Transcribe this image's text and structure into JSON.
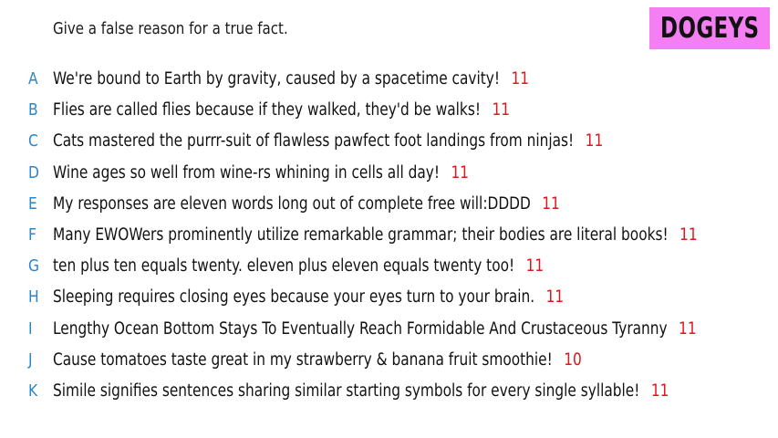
{
  "prompt": "Give a false reason for a true fact.",
  "logo": "DOGEYS",
  "entries": [
    {
      "letter": "A",
      "text": "We're bound to Earth by gravity, caused by a spacetime cavity!",
      "count": "11"
    },
    {
      "letter": "B",
      "text": "Flies are called flies because if they walked, they'd be walks!",
      "count": "11"
    },
    {
      "letter": "C",
      "text": "Cats mastered the purrr-suit of flawless pawfect foot landings from ninjas!",
      "count": "11"
    },
    {
      "letter": "D",
      "text": "Wine ages so well from wine-rs whining in cells all day!",
      "count": "11"
    },
    {
      "letter": "E",
      "text": "My responses are eleven words long out of complete free will:DDDD",
      "count": "11"
    },
    {
      "letter": "F",
      "text": "Many EWOWers prominently utilize remarkable grammar; their bodies are literal books!",
      "count": "11"
    },
    {
      "letter": "G",
      "text": "ten plus ten equals twenty. eleven plus eleven equals twenty too!",
      "count": "11"
    },
    {
      "letter": "H",
      "text": "Sleeping requires closing eyes because your eyes turn to your brain.",
      "count": "11"
    },
    {
      "letter": "I",
      "text": "Lengthy Ocean Bottom Stays To Eventually Reach Formidable And Crustaceous Tyranny",
      "count": "11"
    },
    {
      "letter": "J",
      "text": "Cause tomatoes taste great in my strawberry & banana fruit smoothie!",
      "count": "10"
    },
    {
      "letter": "K",
      "text": "Simile signifies sentences sharing similar starting symbols for every single syllable!",
      "count": "11"
    }
  ]
}
